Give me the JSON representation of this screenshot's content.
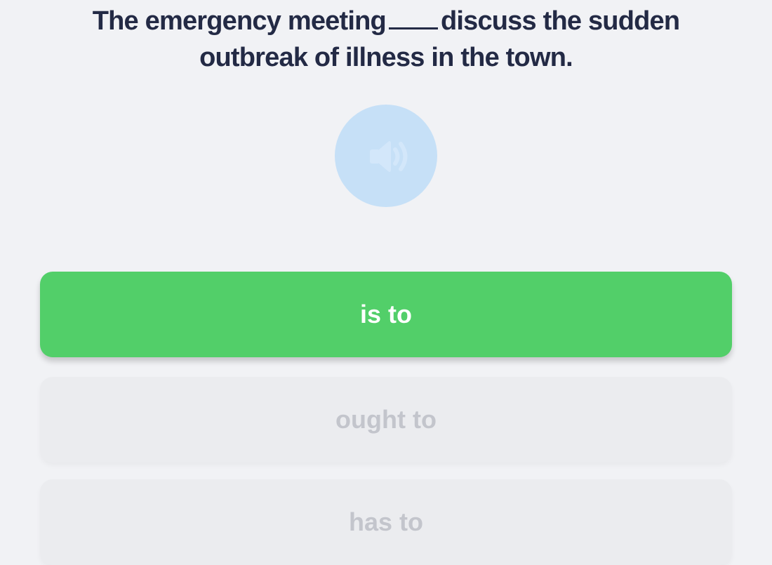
{
  "question": {
    "before_blank": "The emergency meeting",
    "after_blank_line1": "discuss the sudden",
    "line2": "outbreak of illness in the town."
  },
  "audio_button": {
    "icon": "speaker-icon",
    "color": "#c6e0f7",
    "icon_color": "#d3e7fa"
  },
  "options": [
    {
      "label": "is to",
      "state": "selected",
      "color": "#52cf69"
    },
    {
      "label": "ought to",
      "state": "disabled"
    },
    {
      "label": "has to",
      "state": "disabled"
    }
  ],
  "colors": {
    "background": "#f1f2f5",
    "text": "#232a45",
    "disabled_option": "#ebecef",
    "disabled_text": "#c3c5cc"
  }
}
